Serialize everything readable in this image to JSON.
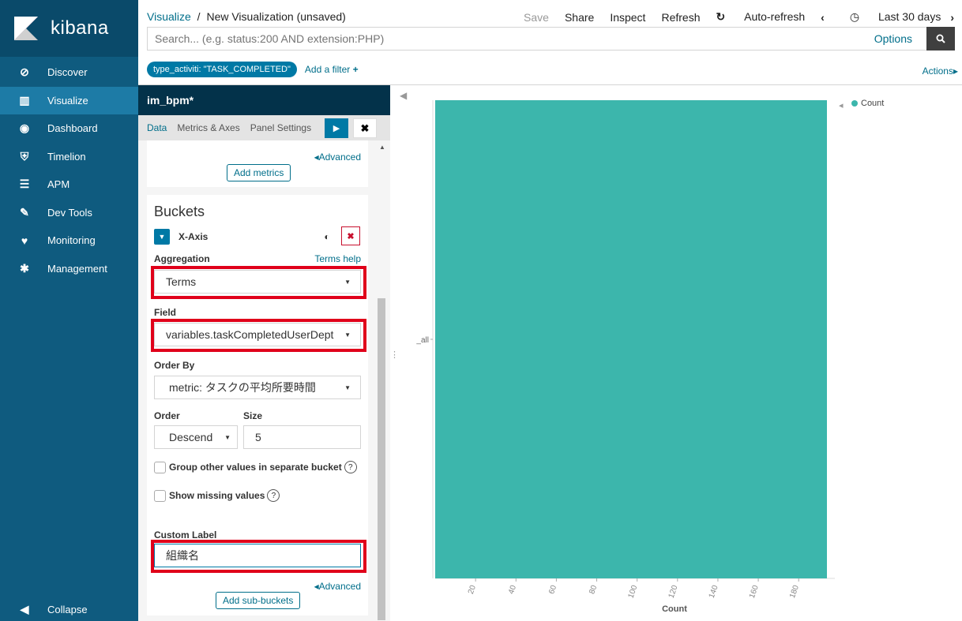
{
  "sidebar": {
    "logo_text": "kibana",
    "items": [
      {
        "label": "Discover",
        "icon": "compass-icon",
        "active": false
      },
      {
        "label": "Visualize",
        "icon": "bar-chart-icon",
        "active": true
      },
      {
        "label": "Dashboard",
        "icon": "dashboard-icon",
        "active": false
      },
      {
        "label": "Timelion",
        "icon": "timelion-icon",
        "active": false
      },
      {
        "label": "APM",
        "icon": "apm-icon",
        "active": false
      },
      {
        "label": "Dev Tools",
        "icon": "wrench-icon",
        "active": false
      },
      {
        "label": "Monitoring",
        "icon": "heartbeat-icon",
        "active": false
      },
      {
        "label": "Management",
        "icon": "gear-icon",
        "active": false
      }
    ],
    "collapse_label": "Collapse"
  },
  "header": {
    "breadcrumb_root": "Visualize",
    "breadcrumb_sep": "/",
    "breadcrumb_current": "New Visualization (unsaved)",
    "save": "Save",
    "share": "Share",
    "inspect": "Inspect",
    "refresh": "Refresh",
    "auto_refresh": "Auto-refresh",
    "time_range": "Last 30 days",
    "search_placeholder": "Search... (e.g. status:200 AND extension:PHP)",
    "options": "Options",
    "filter_pill": "type_activiti: \"TASK_COMPLETED\"",
    "add_filter": "Add a filter",
    "actions": "Actions"
  },
  "editor": {
    "title": "im_bpm*",
    "tabs": [
      "Data",
      "Metrics & Axes",
      "Panel Settings"
    ],
    "advanced": "Advanced",
    "add_metrics": "Add metrics",
    "buckets_heading": "Buckets",
    "x_axis_label": "X-Axis",
    "aggregation_label": "Aggregation",
    "terms_help": "Terms help",
    "aggregation_value": "Terms",
    "field_label": "Field",
    "field_value": "variables.taskCompletedUserDept",
    "order_by_label": "Order By",
    "order_by_value": "metric: タスクの平均所要時間",
    "order_label": "Order",
    "order_value": "Descend",
    "size_label": "Size",
    "size_value": "5",
    "group_other_label": "Group other values in separate bucket",
    "show_missing_label": "Show missing values",
    "custom_label_label": "Custom Label",
    "custom_label_value": "組織名",
    "advanced2": "Advanced",
    "add_sub_buckets": "Add sub-buckets"
  },
  "chart_data": {
    "type": "bar",
    "orientation": "horizontal",
    "categories": [
      "_all"
    ],
    "series": [
      {
        "name": "Count",
        "values": [
          194
        ]
      }
    ],
    "xlabel": "Count",
    "xticks": [
      20,
      40,
      60,
      80,
      100,
      120,
      140,
      160,
      180
    ],
    "xlim": [
      0,
      194
    ],
    "legend_position": "top-right",
    "color": "#3cb6ac"
  }
}
